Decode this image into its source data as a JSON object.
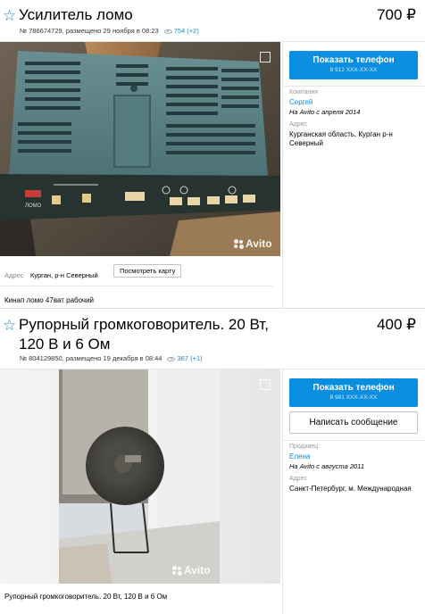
{
  "listings": [
    {
      "title": "Усилитель ломо",
      "price": "700 ₽",
      "meta": "№ 786674729, размещено 29 ноября в 08:23",
      "views": "754 (+2)",
      "phone_button": "Показать телефон",
      "phone_number": "8 912 XXX-XX-XX",
      "seller_label": "Компания",
      "seller_name": "Сергей",
      "seller_since": "На Avito с апреля 2014",
      "address_label": "Адрес",
      "address_value": "Курганская область, Курган р-н Северный",
      "inline_address_label": "Адрес",
      "inline_address_value": "Курган, р-н Северный",
      "map_button": "Посмотреть карту",
      "description": "Кинап ломо 47ват рабочий",
      "watermark": "Avito",
      "device_brand": "ЛОМО"
    },
    {
      "title_line1": "Рупорный громкоговоритель. 20 Вт,",
      "title_line2": "120 В и 6 Ом",
      "price": "400 ₽",
      "meta": "№ 804129850, размещено 19 декабря в 08:44",
      "views": "367 (+1)",
      "phone_button": "Показать телефон",
      "phone_number": "8 981 XXX-XX-XX",
      "message_button": "Написать сообщение",
      "seller_label": "Продавец",
      "seller_name": "Елена",
      "seller_since": "На Avito с августа 2011",
      "address_label": "Адрес",
      "address_value": "Санкт-Петербург, м. Международная",
      "description": "Рупорный громкоговоритель. 20 Вт, 120 В и 6 Ом",
      "watermark": "Avito"
    }
  ],
  "colors": {
    "accent": "#0a8ee0",
    "star": "#0a8ee0"
  },
  "icons": [
    "star-icon",
    "eye-icon",
    "expand-icon",
    "avito-logo-icon"
  ]
}
